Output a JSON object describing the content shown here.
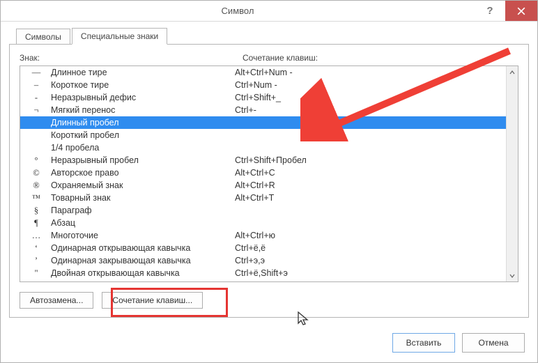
{
  "window": {
    "title": "Символ"
  },
  "tabs": {
    "symbols": "Символы",
    "special": "Специальные знаки"
  },
  "headers": {
    "sign": "Знак:",
    "shortcut": "Сочетание клавиш:"
  },
  "rows": [
    {
      "sym": "—",
      "name": "Длинное тире",
      "key": "Alt+Ctrl+Num -",
      "selected": false
    },
    {
      "sym": "–",
      "name": "Короткое тире",
      "key": "Ctrl+Num -",
      "selected": false
    },
    {
      "sym": "-",
      "name": "Неразрывный дефис",
      "key": "Ctrl+Shift+_",
      "selected": false
    },
    {
      "sym": "¬",
      "name": "Мягкий перенос",
      "key": "Ctrl+-",
      "selected": false
    },
    {
      "sym": "",
      "name": "Длинный пробел",
      "key": "",
      "selected": true
    },
    {
      "sym": "",
      "name": "Короткий пробел",
      "key": "",
      "selected": false
    },
    {
      "sym": "",
      "name": "1/4 пробела",
      "key": "",
      "selected": false
    },
    {
      "sym": "°",
      "name": "Неразрывный пробел",
      "key": "Ctrl+Shift+Пробел",
      "selected": false
    },
    {
      "sym": "©",
      "name": "Авторское право",
      "key": "Alt+Ctrl+C",
      "selected": false
    },
    {
      "sym": "®",
      "name": "Охраняемый знак",
      "key": "Alt+Ctrl+R",
      "selected": false
    },
    {
      "sym": "™",
      "name": "Товарный знак",
      "key": "Alt+Ctrl+T",
      "selected": false
    },
    {
      "sym": "§",
      "name": "Параграф",
      "key": "",
      "selected": false
    },
    {
      "sym": "¶",
      "name": "Абзац",
      "key": "",
      "selected": false
    },
    {
      "sym": "…",
      "name": "Многоточие",
      "key": "Alt+Ctrl+ю",
      "selected": false
    },
    {
      "sym": "‘",
      "name": "Одинарная открывающая кавычка",
      "key": "Ctrl+ё,ё",
      "selected": false
    },
    {
      "sym": "’",
      "name": "Одинарная закрывающая кавычка",
      "key": "Ctrl+э,э",
      "selected": false
    },
    {
      "sym": "\"",
      "name": "Двойная открывающая кавычка",
      "key": "Ctrl+ё,Shift+э",
      "selected": false
    }
  ],
  "buttons": {
    "autocorrect": "Автозамена...",
    "shortcut": "Сочетание клавиш..."
  },
  "footer": {
    "insert": "Вставить",
    "cancel": "Отмена"
  },
  "annotations": {
    "highlight_target": "shortcut-button",
    "arrow_points_to_row_index": 4
  }
}
